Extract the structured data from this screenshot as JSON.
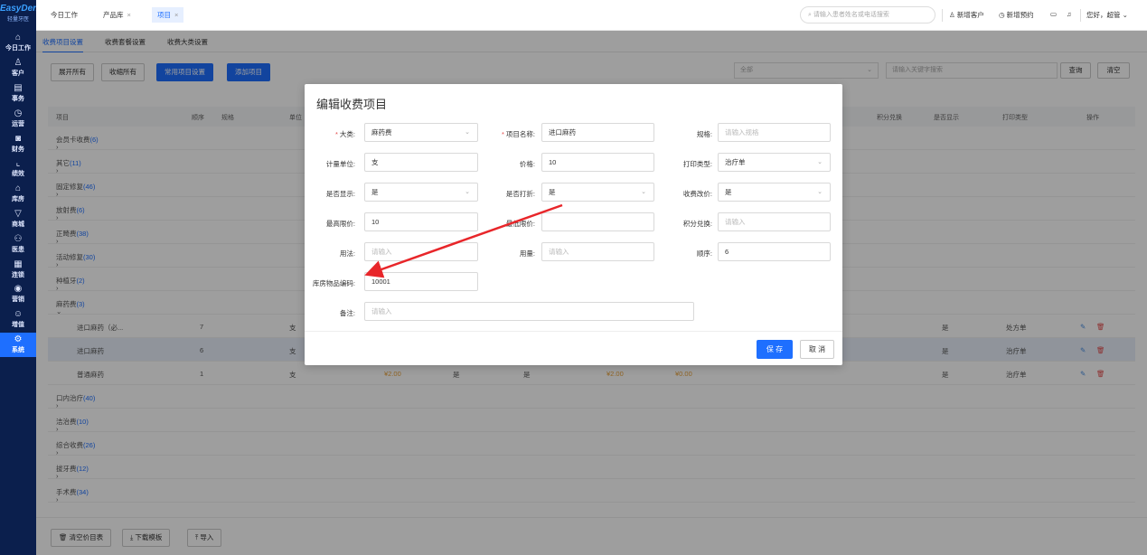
{
  "sidebar": {
    "brand": "EasyDent",
    "brand_sub": "轻量牙医",
    "items": [
      {
        "label": "今日工作",
        "icon": "⌂"
      },
      {
        "label": "客户",
        "icon": "♙"
      },
      {
        "label": "事务",
        "icon": "▤"
      },
      {
        "label": "运营",
        "icon": "◷"
      },
      {
        "label": "财务",
        "icon": "◙"
      },
      {
        "label": "绩效",
        "icon": "⌞"
      },
      {
        "label": "库房",
        "icon": "⌂"
      },
      {
        "label": "商城",
        "icon": "▽"
      },
      {
        "label": "医患",
        "icon": "⚇"
      },
      {
        "label": "连锁",
        "icon": "▦"
      },
      {
        "label": "营销",
        "icon": "◉"
      },
      {
        "label": "增值",
        "icon": "☺"
      },
      {
        "label": "系统",
        "icon": "⚙"
      }
    ]
  },
  "topbar": {
    "tabs": [
      {
        "label": "今日工作",
        "closable": ""
      },
      {
        "label": "产品库",
        "closable": "×"
      },
      {
        "label": "项目",
        "closable": "×"
      }
    ],
    "search_placeholder": "请输入患者姓名或电话搜索",
    "new_customer": "新增客户",
    "new_appointment": "新增预约",
    "greeting": "您好，超管"
  },
  "subtabs": [
    "收费项目设置",
    "收费套餐设置",
    "收费大类设置"
  ],
  "toolbar": {
    "expand_all": "展开所有",
    "collapse_all": "收缩所有",
    "common_items": "常用项目设置",
    "add_item": "添加项目",
    "category_filter": "全部",
    "keyword_placeholder": "请输入关键字搜索",
    "query": "查询",
    "clear": "清空"
  },
  "table": {
    "headers": {
      "item": "项目",
      "order": "顺序",
      "spec": "规格",
      "unit": "单位",
      "points": "积分兑换",
      "show": "是否显示",
      "print_type": "打印类型",
      "action": "操作"
    },
    "categories": [
      {
        "name": "会员卡收费",
        "count": "(6)"
      },
      {
        "name": "其它",
        "count": "(11)"
      },
      {
        "name": "固定修复",
        "count": "(46)"
      },
      {
        "name": "放射费",
        "count": "(6)"
      },
      {
        "name": "正畸费",
        "count": "(38)"
      },
      {
        "name": "活动修复",
        "count": "(30)"
      },
      {
        "name": "种植牙",
        "count": "(2)"
      },
      {
        "name": "麻药费",
        "count": "(3)"
      }
    ],
    "subrows": [
      {
        "name": "进口麻药（必...",
        "order": "7",
        "unit": "支",
        "price": "",
        "show_a": "",
        "show_b": "",
        "price2": "",
        "price3": "",
        "show": "是",
        "print": "处方单"
      },
      {
        "name": "进口麻药",
        "order": "6",
        "unit": "支",
        "price": "",
        "show_a": "",
        "show_b": "",
        "price2": "",
        "price3": "",
        "show": "是",
        "print": "治疗单"
      },
      {
        "name": "普通麻药",
        "order": "1",
        "unit": "支",
        "price": "¥2.00",
        "show_a": "是",
        "show_b": "是",
        "price2": "¥2.00",
        "price3": "¥0.00",
        "show": "是",
        "print": "治疗单"
      }
    ],
    "categories_after": [
      {
        "name": "口内治疗",
        "count": "(40)"
      },
      {
        "name": "洁治费",
        "count": "(10)"
      },
      {
        "name": "综合收费",
        "count": "(26)"
      },
      {
        "name": "拔牙费",
        "count": "(12)"
      },
      {
        "name": "手术费",
        "count": "(34)"
      }
    ]
  },
  "bottombar": {
    "clear_price": "清空价目表",
    "download_template": "下载模板",
    "import": "导入"
  },
  "modal": {
    "title": "编辑收费项目",
    "fields": {
      "category_label": "大类:",
      "category_value": "麻药费",
      "name_label": "项目名称:",
      "name_value": "进口麻药",
      "spec_label": "规格:",
      "spec_placeholder": "请输入规格",
      "unit_label": "计量单位:",
      "unit_value": "支",
      "price_label": "价格:",
      "price_value": "10",
      "print_label": "打印类型:",
      "print_value": "治疗单",
      "show_label": "是否显示:",
      "show_value": "是",
      "discount_label": "是否打折:",
      "discount_value": "是",
      "change_label": "收费改价:",
      "change_value": "是",
      "max_label": "最高限价:",
      "max_value": "10",
      "min_label": "最低限价:",
      "min_value": "",
      "points_label": "积分兑换:",
      "points_placeholder": "请输入",
      "usage_label": "用法:",
      "usage_placeholder": "请输入",
      "dosage_label": "用量:",
      "dosage_placeholder": "请输入",
      "order_label": "顺序:",
      "order_value": "6",
      "code_label": "库房物品编码:",
      "code_value": "10001",
      "note_label": "备注:",
      "note_placeholder": "请输入"
    },
    "save": "保 存",
    "cancel": "取 消"
  },
  "colors": {
    "accent": "#1e6fff",
    "sidebar": "#0b1f4d",
    "annotation": "#e8262a"
  }
}
